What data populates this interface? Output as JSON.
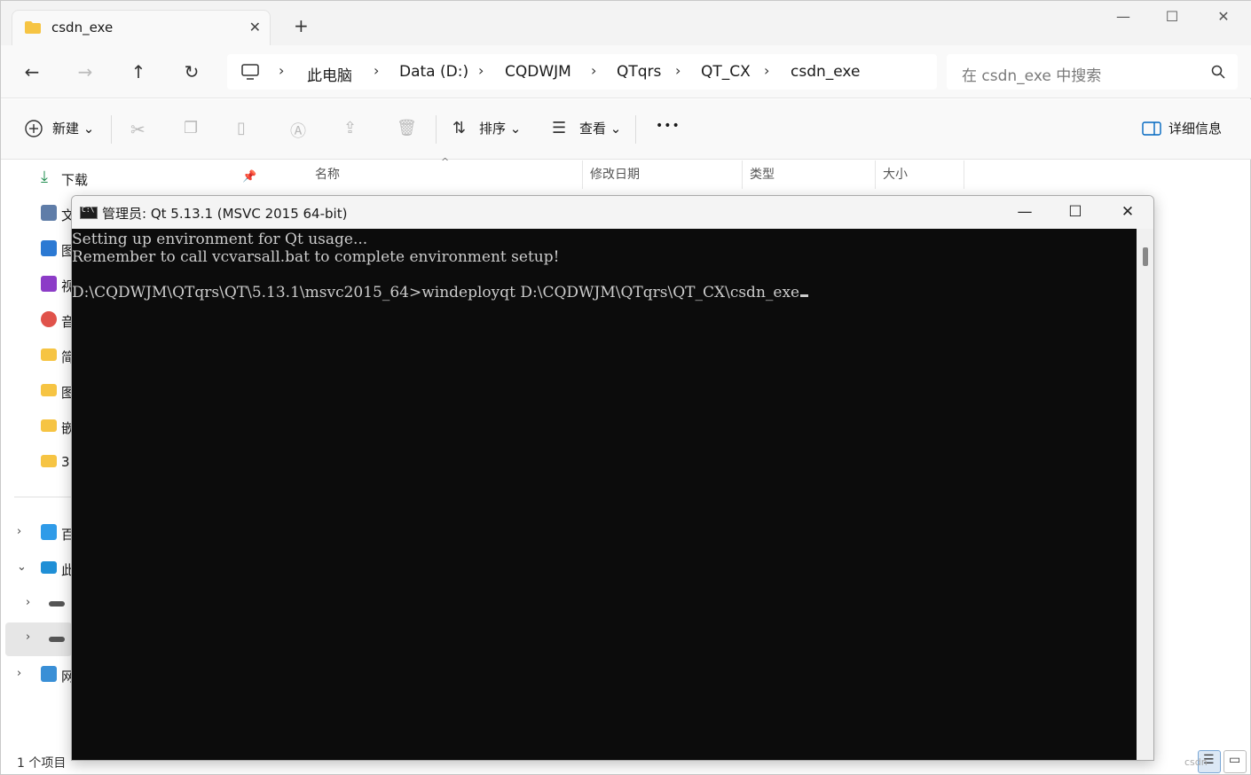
{
  "explorer": {
    "tab_title": "csdn_exe",
    "window_controls": {
      "minimize": "—",
      "maximize": "☐",
      "close": "✕"
    },
    "nav": {
      "back": "←",
      "forward": "→",
      "up": "↑",
      "refresh": "↻"
    },
    "breadcrumb": [
      "此电脑",
      "Data (D:)",
      "CQDWJM",
      "QTqrs",
      "QT_CX",
      "csdn_exe"
    ],
    "search_placeholder": "在 csdn_exe 中搜索",
    "commands": {
      "new": "新建",
      "sort": "排序",
      "view": "查看",
      "more": "•••",
      "details": "详细信息"
    },
    "sidebar": {
      "items": [
        {
          "label": "下载",
          "icon": "download-icon"
        },
        {
          "label": "文",
          "icon": "document-icon"
        },
        {
          "label": "图",
          "icon": "pictures-icon"
        },
        {
          "label": "视",
          "icon": "videos-icon"
        },
        {
          "label": "音",
          "icon": "music-icon"
        },
        {
          "label": "简",
          "icon": "folder-icon"
        },
        {
          "label": "图",
          "icon": "folder-icon"
        },
        {
          "label": "嵌",
          "icon": "folder-icon"
        },
        {
          "label": "3",
          "icon": "folder-icon"
        },
        {
          "label": "百",
          "icon": "cloud-icon"
        },
        {
          "label": "此",
          "icon": "this-pc-icon"
        },
        {
          "label": "",
          "icon": "drive-icon"
        },
        {
          "label": "",
          "icon": "drive-icon"
        },
        {
          "label": "网",
          "icon": "network-icon"
        }
      ]
    },
    "columns": [
      "名称",
      "修改日期",
      "类型",
      "大小"
    ],
    "status": "1 个项目",
    "watermark": "csdn"
  },
  "console": {
    "title": "管理员: Qt 5.13.1 (MSVC 2015 64-bit)",
    "controls": {
      "minimize": "—",
      "maximize": "☐",
      "close": "✕"
    },
    "lines": [
      "Setting up environment for Qt usage...",
      "Remember to call vcvarsall.bat to complete environment setup!",
      "",
      "D:\\CQDWJM\\QTqrs\\QT\\5.13.1\\msvc2015_64>windeployqt D:\\CQDWJM\\QTqrs\\QT_CX\\csdn_exe"
    ]
  },
  "colors": {
    "console_bg": "#0c0c0c",
    "console_text": "#cccccc",
    "folder_yellow": "#f6c443",
    "accent_blue": "#0067c0"
  }
}
